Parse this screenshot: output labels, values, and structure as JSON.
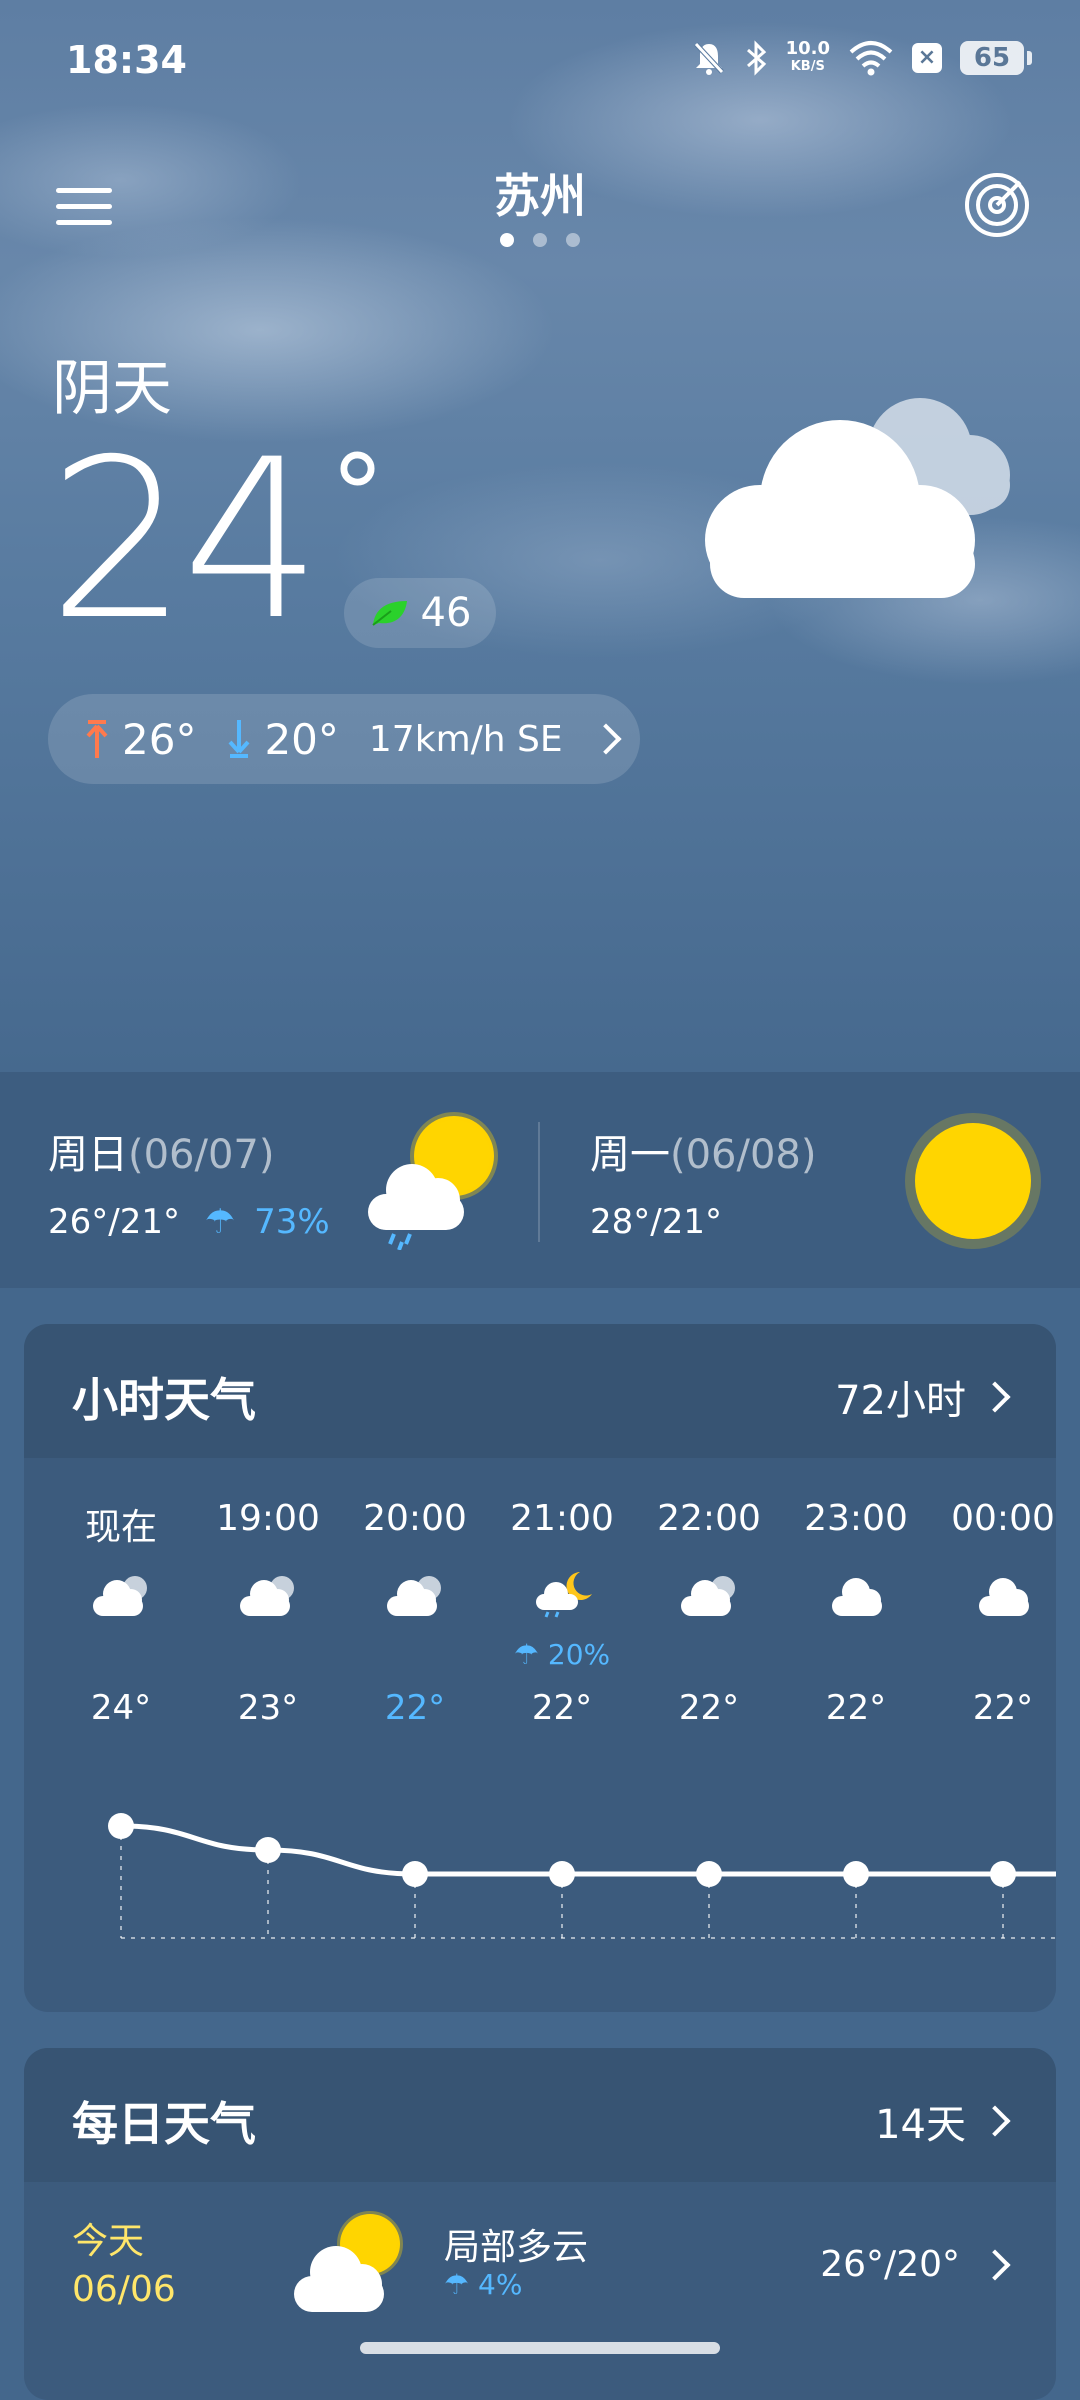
{
  "status": {
    "time": "18:34",
    "speed_value": "10.0",
    "speed_unit": "KB/S",
    "battery": "65"
  },
  "header": {
    "city": "苏州",
    "page_count": 3,
    "active_page": 1
  },
  "current": {
    "condition": "阴天",
    "temperature": "24",
    "degree_symbol": "°",
    "aqi": "46",
    "high": "26°",
    "low": "20°",
    "wind": "17km/h SE"
  },
  "forecast": [
    {
      "day": "周日",
      "date": "(06/07)",
      "range": "26°/21°",
      "rain": "73%",
      "icon": "partly-rain-icon"
    },
    {
      "day": "周一",
      "date": "(06/08)",
      "range": "28°/21°",
      "rain": "",
      "icon": "sun-icon"
    }
  ],
  "hourly": {
    "title": "小时天气",
    "link": "72小时",
    "items": [
      {
        "time": "现在",
        "temp": "24°",
        "rain": "",
        "icon": "cloudy-icon",
        "value": 24
      },
      {
        "time": "19:00",
        "temp": "23°",
        "rain": "",
        "icon": "cloudy-icon",
        "value": 23
      },
      {
        "time": "20:00",
        "temp": "22°",
        "rain": "",
        "icon": "cloudy-icon",
        "value": 22,
        "highlight": true
      },
      {
        "time": "21:00",
        "temp": "22°",
        "rain": "20%",
        "icon": "cloudy-night-rain-icon",
        "value": 22
      },
      {
        "time": "22:00",
        "temp": "22°",
        "rain": "",
        "icon": "cloudy-icon",
        "value": 22
      },
      {
        "time": "23:00",
        "temp": "22°",
        "rain": "",
        "icon": "cloud-icon",
        "value": 22
      },
      {
        "time": "00:00",
        "temp": "22°",
        "rain": "",
        "icon": "cloud-icon",
        "value": 22
      }
    ]
  },
  "daily": {
    "title": "每日天气",
    "link": "14天",
    "today": {
      "label": "今天",
      "date": "06/06",
      "condition": "局部多云",
      "rain": "4%",
      "range": "26°/20°",
      "icon": "partly-cloudy-icon"
    }
  },
  "colors": {
    "accent_blue": "#55b8ff",
    "today_yellow": "#ffe66a",
    "sun": "#ffd500",
    "high_arrow": "#ff7a4d",
    "low_arrow": "#55b8ff",
    "aqi_leaf": "#2bd12b"
  }
}
